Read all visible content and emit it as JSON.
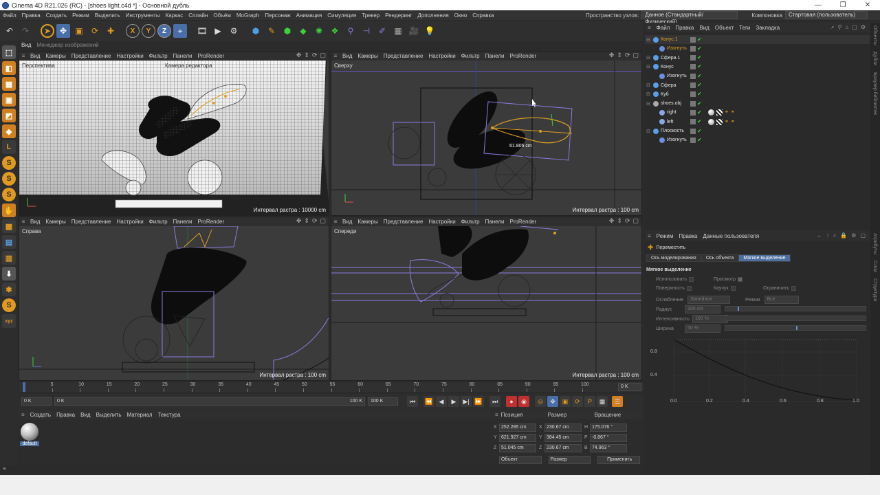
{
  "window": {
    "title": "Cinema 4D R21.026 (RC) - [shoes light.c4d *] - Основной дубль"
  },
  "menu": {
    "items": [
      "Файл",
      "Правка",
      "Создать",
      "Режим",
      "Выделить",
      "Инструменты",
      "Каркас",
      "Сплайн",
      "Объём",
      "MoGraph",
      "Персонаж",
      "Анимация",
      "Симуляция",
      "Трекер",
      "Рендеринг",
      "Дополнения",
      "Окно",
      "Справка"
    ],
    "node_space_label": "Пространство узлов:",
    "node_space_value": "Данное (Стандартный/Физический)",
    "layout_label": "Компоновка",
    "layout_value": "Стартовая (пользователь)"
  },
  "tabs_top": {
    "view": "Вид",
    "image_manager": "Менеджер изображений"
  },
  "viewport_menu": {
    "view": "Вид",
    "cameras": "Камеры",
    "display": "Представление",
    "options": "Настройки",
    "filter": "Фильтр",
    "panels": "Панели",
    "prorender": "ProRender"
  },
  "viewports": {
    "perspective": {
      "label": "Перспектива",
      "camera": "Камера редактора",
      "grid": "Интервал растра : 10000 cm"
    },
    "top": {
      "label": "Сверху",
      "grid": "Интервал растра : 100 cm",
      "measure": "61.805 cm"
    },
    "right": {
      "label": "Справа",
      "grid": "Интервал растра : 100 cm"
    },
    "front": {
      "label": "Спереди",
      "grid": "Интервал растра : 100 cm"
    }
  },
  "timeline": {
    "ticks": [
      "0",
      "5",
      "10",
      "15",
      "20",
      "25",
      "30",
      "35",
      "40",
      "45",
      "50",
      "55",
      "60",
      "65",
      "70",
      "75",
      "80",
      "85",
      "90",
      "95",
      "100"
    ],
    "end_frame": "0 K",
    "start": "0 K",
    "range_start": "0 K",
    "range_end": "100 K",
    "max": "100 K"
  },
  "material_panel": {
    "menu": [
      "Создать",
      "Правка",
      "Вид",
      "Выделить",
      "Материал",
      "Текстура"
    ],
    "material_name": "default"
  },
  "coordinates": {
    "headers": {
      "position": "Позиция",
      "size": "Размер",
      "rotation": "Вращение"
    },
    "rows": [
      {
        "axis": "X",
        "pos": "252.285 cm",
        "saxis": "X",
        "size": "230.67 cm",
        "raxis": "H",
        "rot": "175.076 °"
      },
      {
        "axis": "Y",
        "pos": "621.927 cm",
        "saxis": "Y",
        "size": "384.45 cm",
        "raxis": "P",
        "rot": "-0.867 °"
      },
      {
        "axis": "Z",
        "pos": "51.045 cm",
        "saxis": "Z",
        "size": "230.67 cm",
        "raxis": "B",
        "rot": "74.963 °"
      }
    ],
    "mode": "Объект",
    "size_mode": "Размер",
    "apply": "Применить"
  },
  "object_manager": {
    "menu": [
      "Файл",
      "Правка",
      "Вид",
      "Объект",
      "Теги",
      "Закладка"
    ],
    "objects": [
      {
        "name": "Конус.1",
        "indent": 0,
        "color": "#5aa0e6",
        "orange": true
      },
      {
        "name": "Изогнуть",
        "indent": 1,
        "color": "#6a8fe0",
        "orange": true
      },
      {
        "name": "Сфера.1",
        "indent": 0,
        "color": "#5aa0e6",
        "orange": false
      },
      {
        "name": "Конус",
        "indent": 0,
        "color": "#5aa0e6",
        "orange": false
      },
      {
        "name": "Изогнуть",
        "indent": 1,
        "color": "#6a8fe0",
        "orange": false
      },
      {
        "name": "Сфера",
        "indent": 0,
        "color": "#5aa0e6",
        "orange": false
      },
      {
        "name": "Куб",
        "indent": 0,
        "color": "#5aa0e6",
        "orange": false
      },
      {
        "name": "shoes.obj",
        "indent": 0,
        "color": "#aaaaaa",
        "orange": false
      },
      {
        "name": "right",
        "indent": 1,
        "color": "#8aa8e8",
        "orange": false
      },
      {
        "name": "left",
        "indent": 1,
        "color": "#8aa8e8",
        "orange": false
      },
      {
        "name": "Плоскость",
        "indent": 0,
        "color": "#5aa0e6",
        "orange": false
      },
      {
        "name": "Изогнуть",
        "indent": 1,
        "color": "#6a8fe0",
        "orange": false
      }
    ]
  },
  "attributes": {
    "menu": [
      "Режим",
      "Правка",
      "Данные пользователя"
    ],
    "tool": "Переместить",
    "tabs": [
      "Ось моделирования",
      "Ось объекта",
      "Мягкое выделение"
    ],
    "section": "Мягкое выделение",
    "fields": {
      "use": "Использовать",
      "preview": "Просмотр",
      "surface": "Поверхность",
      "rubber": "Каучук",
      "restrict": "Ограничить",
      "falloff": "Ослабление",
      "falloff_value": "Линейное",
      "mode": "Режим",
      "mode_value": "Все",
      "radius": "Радиус",
      "radius_value": "100 cm",
      "strength": "Интенсивность",
      "strength_value": "100 %",
      "width": "Ширина",
      "width_value": "50 %"
    },
    "graph": {
      "y_labels": [
        "0.8",
        "0.4"
      ],
      "x_labels": [
        "0.0",
        "0.2",
        "0.4",
        "0.6",
        "0.8",
        "1.0"
      ]
    }
  },
  "right_tabs": [
    "Объекты",
    "Дубли",
    "Браузер библиотек",
    "Атрибуты",
    "Слои",
    "Структура"
  ],
  "axis_marks": {
    "rotation_tb": [
      "X",
      "Y",
      "Z"
    ]
  }
}
